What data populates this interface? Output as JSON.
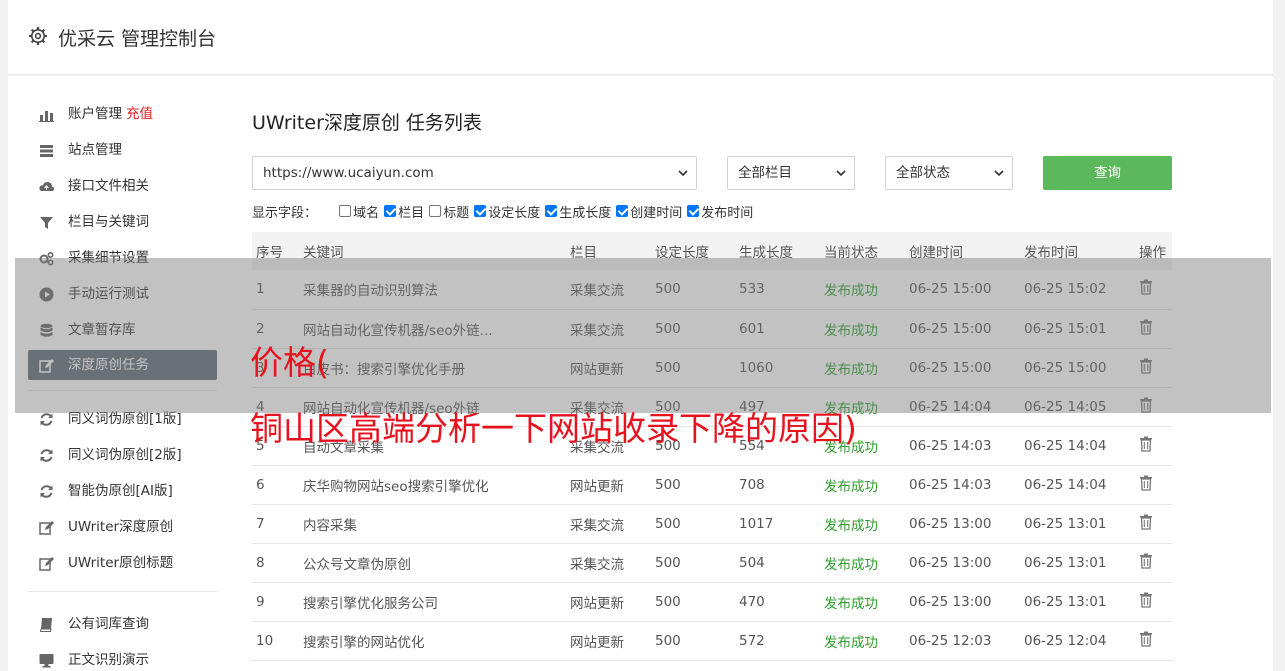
{
  "header": {
    "title": "优采云 管理控制台"
  },
  "sidebar": {
    "group1": [
      {
        "label": "账户管理",
        "extra": "充值",
        "icon": "bar-chart-icon"
      },
      {
        "label": "站点管理",
        "icon": "server-icon"
      },
      {
        "label": "接口文件相关",
        "icon": "cloud-upload-icon"
      },
      {
        "label": "栏目与关键词",
        "icon": "filter-icon"
      },
      {
        "label": "采集细节设置",
        "icon": "gears-icon"
      },
      {
        "label": "手动运行测试",
        "icon": "play-circle-icon"
      },
      {
        "label": "文章暂存库",
        "icon": "database-icon"
      },
      {
        "label": "深度原创任务",
        "icon": "edit-icon",
        "active": true
      }
    ],
    "group2": [
      {
        "label": "同义词伪原创[1版]",
        "icon": "refresh-icon"
      },
      {
        "label": "同义词伪原创[2版]",
        "icon": "refresh-icon"
      },
      {
        "label": "智能伪原创[AI版]",
        "icon": "refresh-icon"
      },
      {
        "label": "UWriter深度原创",
        "icon": "edit-icon"
      },
      {
        "label": "UWriter原创标题",
        "icon": "edit-icon"
      }
    ],
    "group3": [
      {
        "label": "公有词库查询",
        "icon": "book-icon"
      },
      {
        "label": "正文识别演示",
        "icon": "monitor-icon"
      }
    ]
  },
  "page": {
    "title": "UWriter深度原创 任务列表"
  },
  "filters": {
    "site": "https://www.ucaiyun.com",
    "column": "全部栏目",
    "status": "全部状态",
    "query_label": "查询"
  },
  "fields": {
    "label": "显示字段：",
    "items": [
      {
        "label": "域名",
        "checked": false
      },
      {
        "label": "栏目",
        "checked": true
      },
      {
        "label": "标题",
        "checked": false
      },
      {
        "label": "设定长度",
        "checked": true
      },
      {
        "label": "生成长度",
        "checked": true
      },
      {
        "label": "创建时间",
        "checked": true
      },
      {
        "label": "发布时间",
        "checked": true
      }
    ]
  },
  "table": {
    "headers": [
      "序号",
      "关键词",
      "栏目",
      "设定长度",
      "生成长度",
      "当前状态",
      "创建时间",
      "发布时间",
      "操作"
    ],
    "rows": [
      {
        "no": "1",
        "keyword": "采集器的自动识别算法",
        "column": "采集交流",
        "set_len": "500",
        "gen_len": "533",
        "status": "发布成功",
        "created": "06-25 15:00",
        "published": "06-25 15:02"
      },
      {
        "no": "2",
        "keyword": "网站自动化宣传机器/seo外链...",
        "column": "采集交流",
        "set_len": "500",
        "gen_len": "601",
        "status": "发布成功",
        "created": "06-25 15:00",
        "published": "06-25 15:01"
      },
      {
        "no": "3",
        "keyword": "白皮书：搜索引擎优化手册",
        "column": "网站更新",
        "set_len": "500",
        "gen_len": "1060",
        "status": "发布成功",
        "created": "06-25 15:00",
        "published": "06-25 15:00"
      },
      {
        "no": "4",
        "keyword": "网站自动化宣传机器/seo外链",
        "column": "采集交流",
        "set_len": "500",
        "gen_len": "497",
        "status": "发布成功",
        "created": "06-25 14:04",
        "published": "06-25 14:05"
      },
      {
        "no": "5",
        "keyword": "自动文章采集",
        "column": "采集交流",
        "set_len": "500",
        "gen_len": "554",
        "status": "发布成功",
        "created": "06-25 14:03",
        "published": "06-25 14:04"
      },
      {
        "no": "6",
        "keyword": "庆华购物网站seo搜索引擎优化",
        "column": "网站更新",
        "set_len": "500",
        "gen_len": "708",
        "status": "发布成功",
        "created": "06-25 14:03",
        "published": "06-25 14:04"
      },
      {
        "no": "7",
        "keyword": "内容采集",
        "column": "采集交流",
        "set_len": "500",
        "gen_len": "1017",
        "status": "发布成功",
        "created": "06-25 13:00",
        "published": "06-25 13:01"
      },
      {
        "no": "8",
        "keyword": "公众号文章伪原创",
        "column": "采集交流",
        "set_len": "500",
        "gen_len": "504",
        "status": "发布成功",
        "created": "06-25 13:00",
        "published": "06-25 13:01"
      },
      {
        "no": "9",
        "keyword": "搜索引擎优化服务公司",
        "column": "网站更新",
        "set_len": "500",
        "gen_len": "470",
        "status": "发布成功",
        "created": "06-25 13:00",
        "published": "06-25 13:01"
      },
      {
        "no": "10",
        "keyword": "搜索引擎的网站优化",
        "column": "网站更新",
        "set_len": "500",
        "gen_len": "572",
        "status": "发布成功",
        "created": "06-25 12:03",
        "published": "06-25 12:04"
      }
    ]
  },
  "overlay": {
    "line1": "价格(",
    "line2": "铜山区高端分析一下网站收录下降的原因)"
  }
}
